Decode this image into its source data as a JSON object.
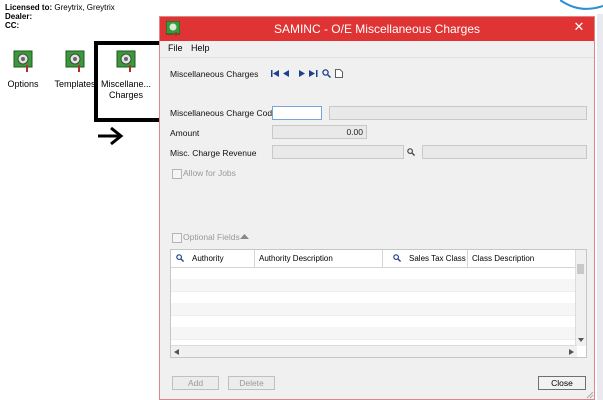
{
  "license": {
    "licensed_label": "Licensed to:",
    "licensed_value": "Greytrix,  Greytrix",
    "dealer_label": "Dealer:",
    "cc_label": "CC:"
  },
  "desktop": {
    "icons": [
      {
        "label": "Options",
        "icon": "sage-module-icon"
      },
      {
        "label": "Templates",
        "icon": "sage-module-icon"
      },
      {
        "label_line1": "Miscellane...",
        "label_line2": "Charges",
        "icon": "sage-module-icon"
      }
    ],
    "arrow": "right-arrow-icon"
  },
  "window": {
    "title": "SAMINC - O/E Miscellaneous Charges",
    "menu": [
      "File",
      "Help"
    ],
    "form": {
      "misc_charges_label": "Miscellaneous Charges",
      "code_label": "Miscellaneous Charge Code",
      "code_value": "",
      "code_desc_value": "",
      "amount_label": "Amount",
      "amount_value": "0.00",
      "revenue_label": "Misc. Charge Revenue",
      "revenue_value": "",
      "revenue_desc_value": "",
      "allow_jobs_label": "Allow for Jobs",
      "optional_fields_label": "Optional Fields"
    },
    "grid": {
      "columns": [
        "Authority",
        "Authority Description",
        "Sales Tax Class",
        "Class Description"
      ],
      "rows": []
    },
    "buttons": {
      "add": "Add",
      "delete": "Delete",
      "close": "Close"
    },
    "colors": {
      "titlebar": "#e03333",
      "body": "#f0f0f0",
      "nav_icons": "#1f3f8f"
    }
  }
}
